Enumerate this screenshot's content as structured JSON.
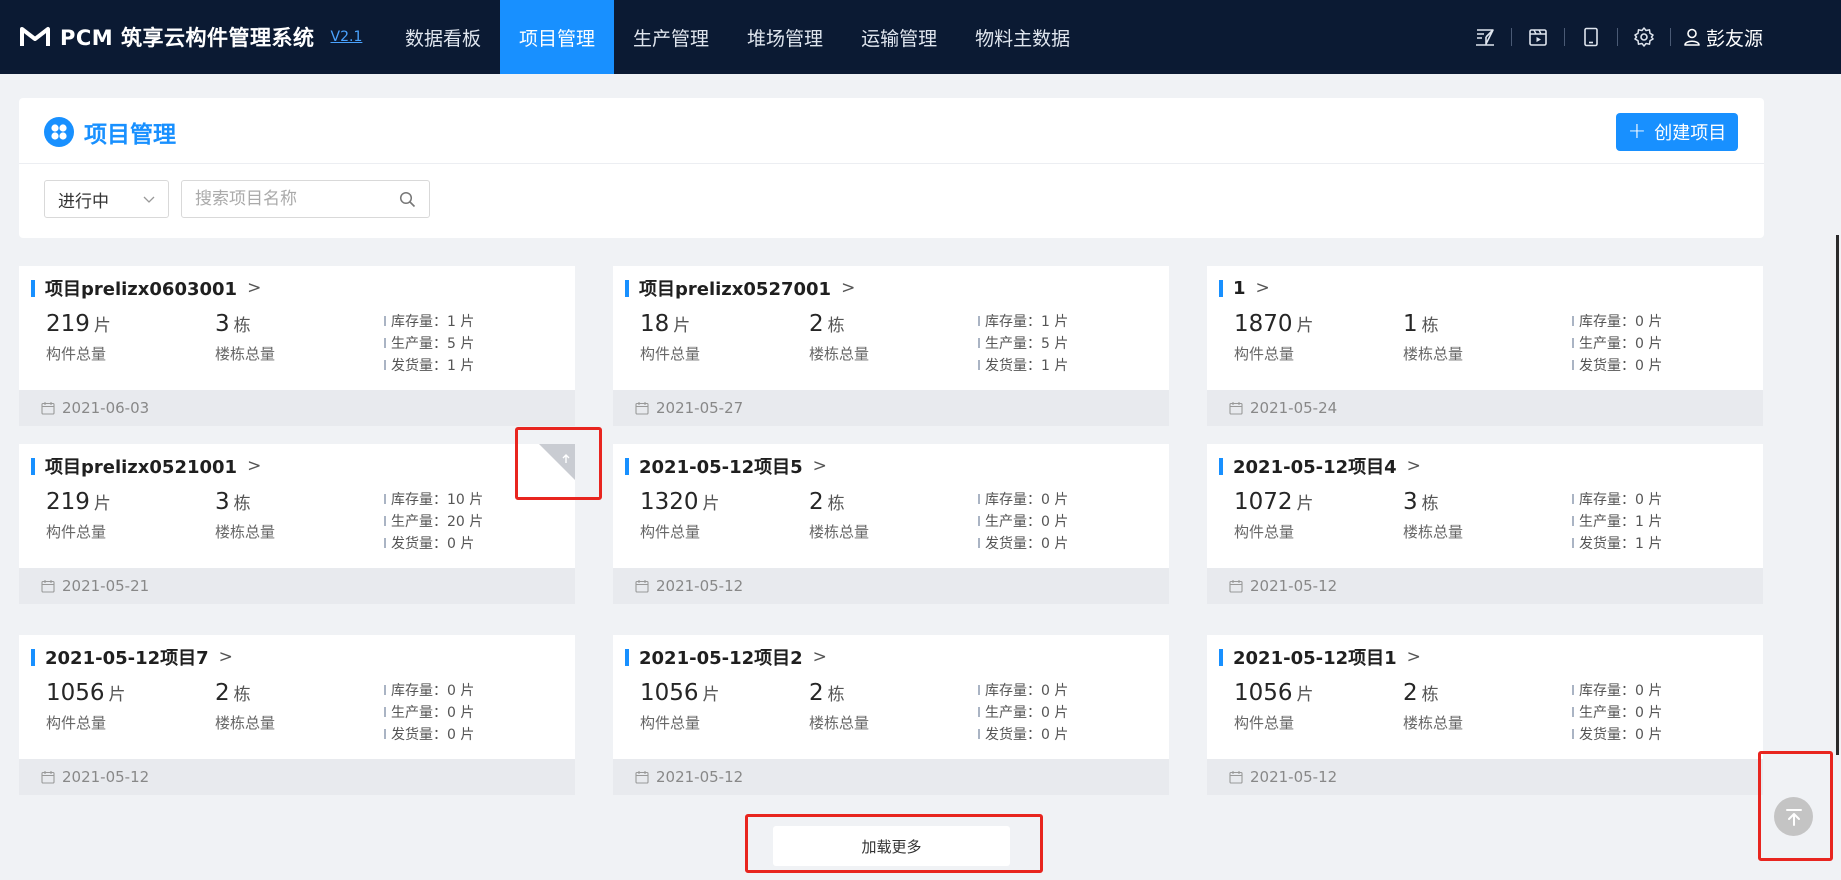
{
  "app": {
    "brand_name": "PCM 筑享云构件管理系统",
    "version": "V2.1",
    "user_name": "彭友源"
  },
  "nav": {
    "items": [
      "数据看板",
      "项目管理",
      "生产管理",
      "堆场管理",
      "运输管理",
      "物料主数据"
    ],
    "active": "项目管理"
  },
  "toolbar_icons": [
    "send-icon",
    "video-icon",
    "tablet-icon",
    "gear-icon",
    "user-icon"
  ],
  "page": {
    "title": "项目管理",
    "create_label": "创建项目",
    "status_filter": "进行中",
    "search_placeholder": "搜索项目名称"
  },
  "labels": {
    "components_total": "构件总量",
    "buildings_total": "楼栋总量",
    "stock": "库存量：",
    "produced": "生产量：",
    "shipped": "发货量：",
    "unit_piece": "片",
    "unit_building": "栋"
  },
  "projects": [
    {
      "name": "项目prelizx0603001",
      "components": "219",
      "buildings": "3",
      "stock": "1 片",
      "produced": "5 片",
      "shipped": "1 片",
      "date": "2021-06-03"
    },
    {
      "name": "项目prelizx0527001",
      "components": "18",
      "buildings": "2",
      "stock": "1 片",
      "produced": "5 片",
      "shipped": "1 片",
      "date": "2021-05-27"
    },
    {
      "name": "1",
      "components": "1870",
      "buildings": "1",
      "stock": "0 片",
      "produced": "0 片",
      "shipped": "0 片",
      "date": "2021-05-24"
    },
    {
      "name": "项目prelizx0521001",
      "components": "219",
      "buildings": "3",
      "stock": "10 片",
      "produced": "20 片",
      "shipped": "0 片",
      "date": "2021-05-21"
    },
    {
      "name": "2021-05-12项目5",
      "components": "1320",
      "buildings": "2",
      "stock": "0 片",
      "produced": "0 片",
      "shipped": "0 片",
      "date": "2021-05-12"
    },
    {
      "name": "2021-05-12项目4",
      "components": "1072",
      "buildings": "3",
      "stock": "0 片",
      "produced": "1 片",
      "shipped": "1 片",
      "date": "2021-05-12"
    },
    {
      "name": "2021-05-12项目7",
      "components": "1056",
      "buildings": "2",
      "stock": "0 片",
      "produced": "0 片",
      "shipped": "0 片",
      "date": "2021-05-12"
    },
    {
      "name": "2021-05-12项目2",
      "components": "1056",
      "buildings": "2",
      "stock": "0 片",
      "produced": "0 片",
      "shipped": "0 片",
      "date": "2021-05-12"
    },
    {
      "name": "2021-05-12项目1",
      "components": "1056",
      "buildings": "2",
      "stock": "0 片",
      "produced": "0 片",
      "shipped": "0 片",
      "date": "2021-05-12"
    }
  ],
  "load_more_label": "加载更多",
  "colors": {
    "nav_bg": "#0b1a33",
    "accent": "#1890ff",
    "annotation": "#e8251f"
  }
}
